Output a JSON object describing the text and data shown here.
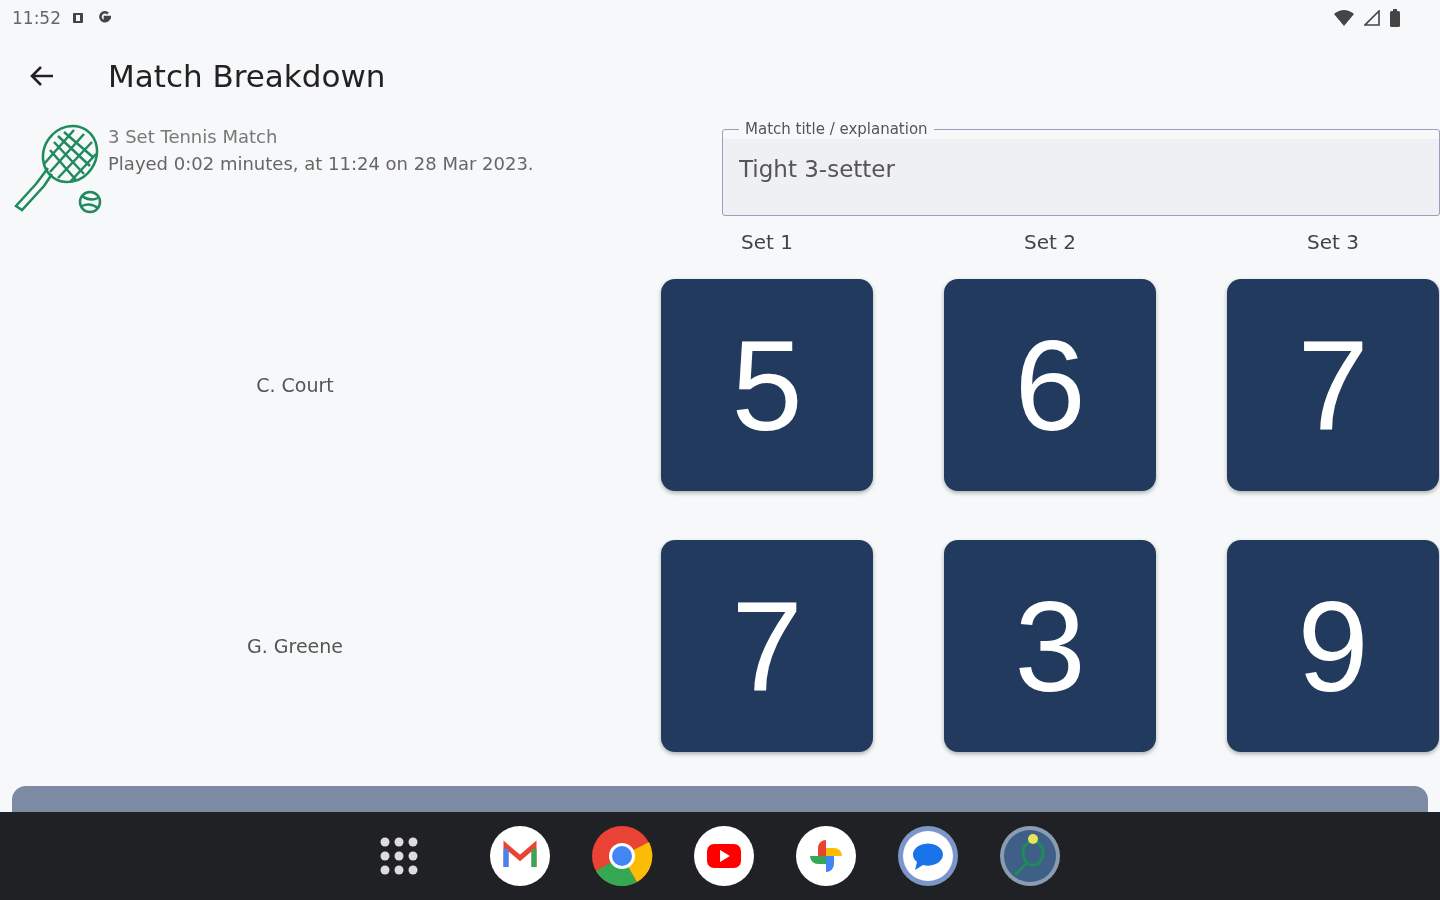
{
  "status_bar": {
    "time": "11:52"
  },
  "app_bar": {
    "title": "Match Breakdown"
  },
  "match": {
    "type": "3 Set Tennis Match",
    "details": "Played 0:02 minutes, at 11:24 on 28 Mar 2023."
  },
  "title_field": {
    "label": "Match title / explanation",
    "value": "Tight 3-setter"
  },
  "sets": [
    "Set 1",
    "Set 2",
    "Set 3"
  ],
  "players": [
    {
      "name": "C. Court",
      "scores": [
        "5",
        "6",
        "7"
      ]
    },
    {
      "name": "G. Greene",
      "scores": [
        "7",
        "3",
        "9"
      ]
    }
  ]
}
